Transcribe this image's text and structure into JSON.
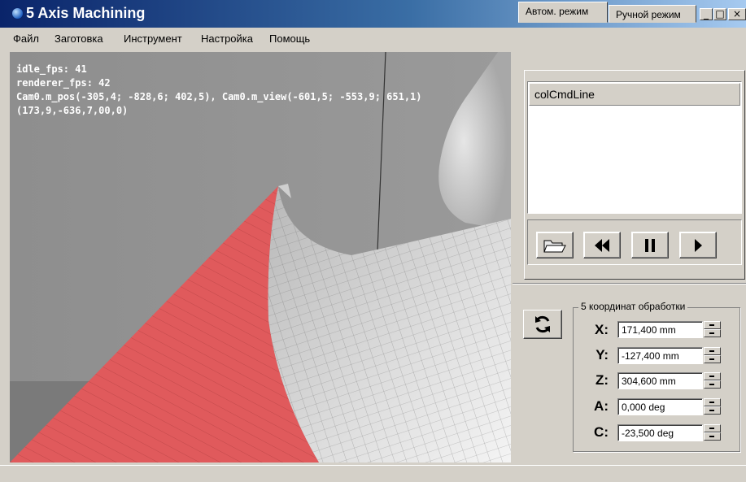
{
  "window": {
    "title": "5 Axis Machining",
    "minimize": "_",
    "maximize": "□",
    "close": "×"
  },
  "menu": [
    "Файл",
    "Заготовка",
    "Инструмент",
    "Настройка",
    "Помощь"
  ],
  "viewport": {
    "overlay": [
      "idle_fps: 41",
      "renderer_fps: 42",
      "Cam0.m_pos(-305,4; -828,6; 402,5), Cam0.m_view(-601,5; -553,9; 651,1)",
      "(173,9,-636,7,00,0)"
    ],
    "part_color": "#e05a5c"
  },
  "tabs": [
    {
      "label": "Автом. режим",
      "active": true
    },
    {
      "label": "Ручной режим",
      "active": false
    }
  ],
  "command_list": {
    "header": "colCmdLine"
  },
  "toolbar": {
    "open_icon": "folder-open-icon",
    "rewind_icon": "rewind-icon",
    "pause_icon": "pause-icon",
    "play_icon": "play-icon"
  },
  "coordinates": {
    "group_title": "5 координат обработки",
    "refresh_icon": "refresh-icon",
    "axes": [
      {
        "label": "X:",
        "value": "171,400 mm"
      },
      {
        "label": "Y:",
        "value": "-127,400 mm"
      },
      {
        "label": "Z:",
        "value": "304,600 mm"
      },
      {
        "label": "A:",
        "value": "0,000 deg"
      },
      {
        "label": "C:",
        "value": "-23,500 deg"
      }
    ]
  }
}
